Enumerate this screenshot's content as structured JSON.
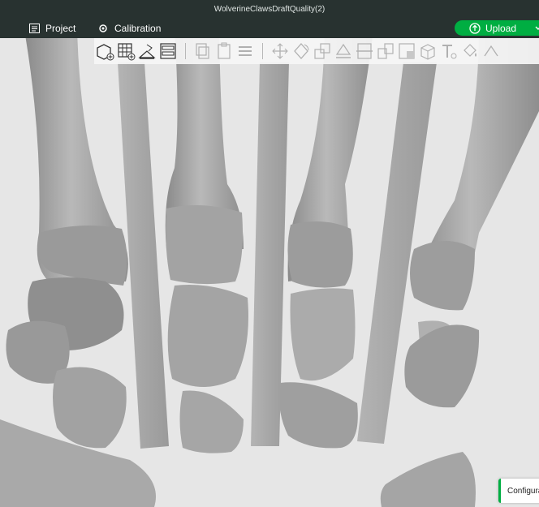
{
  "window": {
    "title": "WolverineClawsDraftQuality(2)"
  },
  "menubar": {
    "project_label": "Project",
    "calibration_label": "Calibration",
    "upload_label": "Upload"
  },
  "toolbar": {
    "tools": [
      "add-cube",
      "add-plate",
      "auto-orient",
      "arrange",
      "copy",
      "paste",
      "layers",
      "move",
      "rotate",
      "scale",
      "lay-on-face",
      "cut",
      "split-objects",
      "split-parts",
      "support",
      "variable-layer-height",
      "text",
      "paint"
    ]
  },
  "notification": {
    "text": "Configura"
  },
  "colors": {
    "brand": "#00ae42",
    "titlebar": "#283230",
    "model": "#a8a8a8",
    "bed": "#e6e6e6"
  }
}
